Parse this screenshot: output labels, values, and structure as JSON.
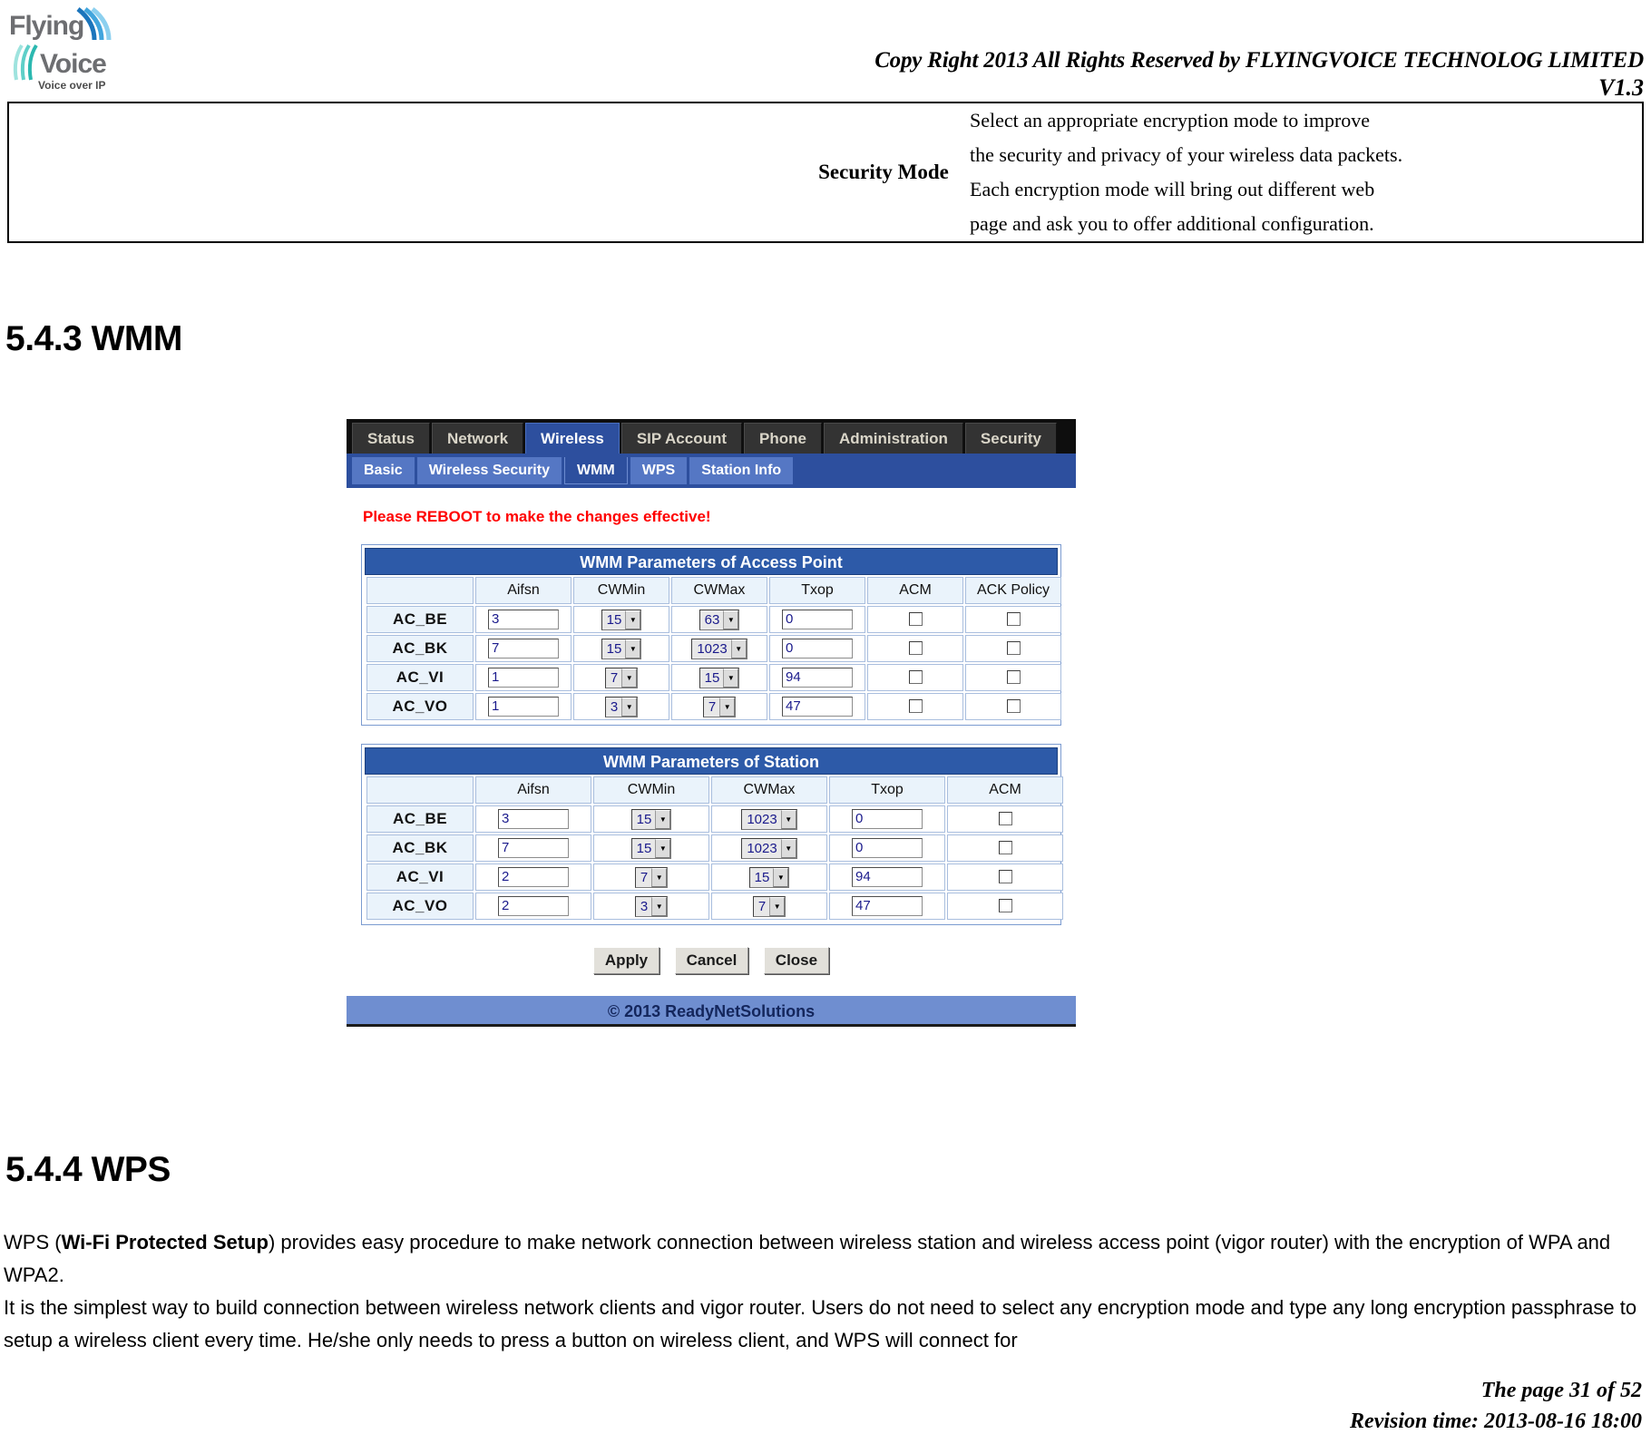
{
  "header": {
    "copyright": "Copy Right 2013 All Rights Reserved by FLYINGVOICE TECHNOLOG LIMITED",
    "version": "V1.3",
    "logo_line1": "Flying",
    "logo_line2": "Voice",
    "logo_tagline": "Voice over IP"
  },
  "security_mode_table": {
    "label": "Security Mode",
    "description": "Select an appropriate encryption mode to improve the security and privacy of your wireless data packets. Each encryption mode will bring out different web page and ask you to offer additional configuration.",
    "description_lines": [
      "Select an appropriate encryption mode to improve",
      "the security and privacy of your wireless data packets.",
      "Each encryption mode will bring out different web",
      "page and ask you to offer additional configuration."
    ]
  },
  "sections": {
    "wmm_heading": "5.4.3 WMM",
    "wps_heading": "5.4.4 WPS"
  },
  "router_ui": {
    "top_tabs": [
      {
        "label": "Status",
        "active": false
      },
      {
        "label": "Network",
        "active": false
      },
      {
        "label": "Wireless",
        "active": true
      },
      {
        "label": "SIP Account",
        "active": false
      },
      {
        "label": "Phone",
        "active": false
      },
      {
        "label": "Administration",
        "active": false
      },
      {
        "label": "Security",
        "active": false
      }
    ],
    "sub_tabs": [
      {
        "label": "Basic",
        "active": false
      },
      {
        "label": "Wireless Security",
        "active": false
      },
      {
        "label": "WMM",
        "active": true
      },
      {
        "label": "WPS",
        "active": false
      },
      {
        "label": "Station Info",
        "active": false
      }
    ],
    "reboot_message": "Please REBOOT to make the changes effective!",
    "ap_panel": {
      "title": "WMM Parameters of Access Point",
      "columns": [
        "",
        "Aifsn",
        "CWMin",
        "CWMax",
        "Txop",
        "ACM",
        "ACK Policy"
      ],
      "rows": [
        {
          "name": "AC_BE",
          "aifsn": "3",
          "cwmin": "15",
          "cwmax": "63",
          "txop": "0",
          "acm": false,
          "ack_policy": false
        },
        {
          "name": "AC_BK",
          "aifsn": "7",
          "cwmin": "15",
          "cwmax": "1023",
          "txop": "0",
          "acm": false,
          "ack_policy": false
        },
        {
          "name": "AC_VI",
          "aifsn": "1",
          "cwmin": "7",
          "cwmax": "15",
          "txop": "94",
          "acm": false,
          "ack_policy": false
        },
        {
          "name": "AC_VO",
          "aifsn": "1",
          "cwmin": "3",
          "cwmax": "7",
          "txop": "47",
          "acm": false,
          "ack_policy": false
        }
      ]
    },
    "station_panel": {
      "title": "WMM Parameters of Station",
      "columns": [
        "",
        "Aifsn",
        "CWMin",
        "CWMax",
        "Txop",
        "ACM"
      ],
      "rows": [
        {
          "name": "AC_BE",
          "aifsn": "3",
          "cwmin": "15",
          "cwmax": "1023",
          "txop": "0",
          "acm": false
        },
        {
          "name": "AC_BK",
          "aifsn": "7",
          "cwmin": "15",
          "cwmax": "1023",
          "txop": "0",
          "acm": false
        },
        {
          "name": "AC_VI",
          "aifsn": "2",
          "cwmin": "7",
          "cwmax": "15",
          "txop": "94",
          "acm": false
        },
        {
          "name": "AC_VO",
          "aifsn": "2",
          "cwmin": "3",
          "cwmax": "7",
          "txop": "47",
          "acm": false
        }
      ]
    },
    "buttons": {
      "apply": "Apply",
      "cancel": "Cancel",
      "close": "Close"
    },
    "footer": "© 2013 ReadyNetSolutions"
  },
  "wps_body": {
    "para1_part1": "WPS (",
    "para1_bold": "Wi-Fi Protected Setup",
    "para1_part2": ") provides easy procedure to make network connection between wireless station and wireless access point (vigor router) with the encryption of WPA and WPA2.",
    "para2": "It is the simplest way to build connection between wireless network clients and vigor router. Users do not need to select any encryption mode and type any long encryption passphrase to setup a wireless client every time. He/she only needs to press a button on wireless client, and WPS will connect for"
  },
  "page_footer": {
    "page": "The page 31 of 52",
    "revision": "Revision time: 2013-08-16 18:00"
  },
  "colors": {
    "nav_active": "#2d4f9e",
    "panel_title": "#2d5aa8",
    "alert_red": "#ff0000",
    "footer_bar": "#6f8ed0"
  }
}
